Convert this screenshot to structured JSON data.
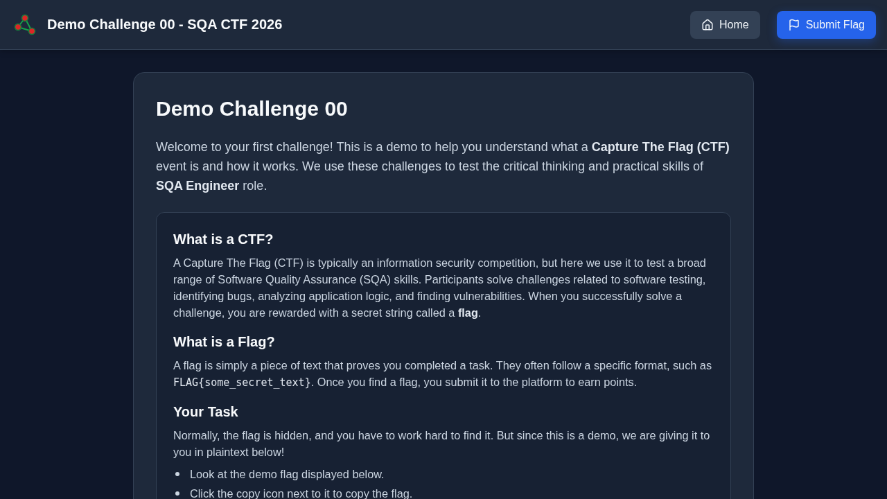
{
  "header": {
    "title": "Demo Challenge 00 - SQA CTF 2026",
    "buttons": [
      {
        "kind": "home",
        "label": "Home"
      },
      {
        "kind": "submit",
        "label": "Submit Flag"
      }
    ]
  },
  "challenge": {
    "title": "Demo Challenge 00",
    "intro": "Welcome to your first challenge! This is a demo to help you understand what a **Capture The Flag (CTF)** event is and how it works. We use these challenges to test the critical thinking and practical skills of **SQA Engineer** role.",
    "sections": [
      {
        "heading": "What is a CTF?",
        "body": [
          {
            "kind": "text",
            "text": "A Capture The Flag (CTF) is typically an information security competition, but here we use it to test a broad range of Software Quality Assurance (SQA) skills. Participants solve challenges related to software testing, identifying bugs, analyzing application logic, and finding vulnerabilities. When you successfully solve a challenge, you are rewarded with a secret string called a **flag**."
          }
        ]
      },
      {
        "heading": "What is a Flag?",
        "body": [
          {
            "kind": "text",
            "text": "A flag is simply a piece of text that proves you completed a task. They often follow a specific format, such as "
          },
          {
            "kind": "code",
            "text": "FLAG{some_secret_text}"
          },
          {
            "kind": "text",
            "text": ". Once you find a flag, you submit it to the platform to earn points."
          }
        ]
      },
      {
        "heading": "Your Task",
        "body": [
          {
            "kind": "text",
            "text": "Normally, the flag is hidden, and you have to work hard to find it. But since this is a demo, we are giving it to you in plaintext below!"
          }
        ],
        "bullets": [
          "Look at the demo flag displayed below.",
          "Click the copy icon next to it to copy the flag."
        ]
      }
    ]
  }
}
